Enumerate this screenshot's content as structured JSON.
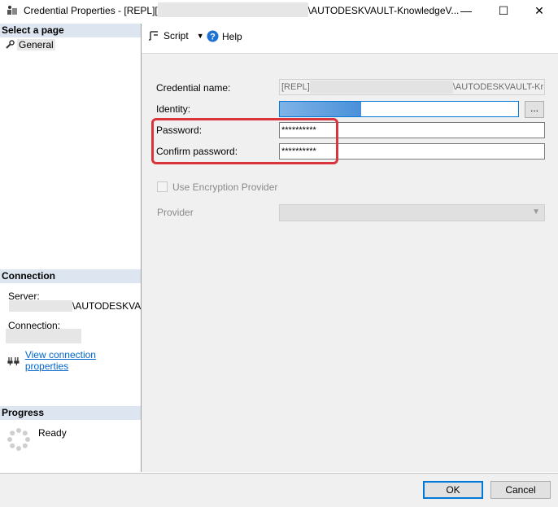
{
  "window": {
    "title_prefix": "Credential Properties - [REPL][",
    "title_suffix": "\\AUTODESKVAULT-KnowledgeV...",
    "minimize": "—",
    "maximize": "☐",
    "close": "✕"
  },
  "left": {
    "select_page_heading": "Select a page",
    "pages": [
      {
        "label": "General",
        "icon": "wrench-icon"
      }
    ],
    "connection_heading": "Connection",
    "server_label": "Server:",
    "server_value": "\\AUTODESKVAU",
    "connection_label": "Connection:",
    "view_connection_properties": "View connection properties",
    "progress_heading": "Progress",
    "progress_status": "Ready"
  },
  "toolbar": {
    "script_label": "Script",
    "help_label": "Help"
  },
  "form": {
    "credential_name_label": "Credential name:",
    "credential_name_prefix": "[REPL]",
    "credential_name_suffix": "\\AUTODESKVAULT-Kr",
    "identity_label": "Identity:",
    "browse_label": "...",
    "password_label": "Password:",
    "password_value": "**********",
    "confirm_password_label": "Confirm password:",
    "confirm_password_value": "**********",
    "use_encryption_label": "Use Encryption Provider",
    "use_encryption_checked": false,
    "provider_label": "Provider",
    "highlight_color": "#d9343b"
  },
  "buttons": {
    "ok": "OK",
    "cancel": "Cancel"
  }
}
